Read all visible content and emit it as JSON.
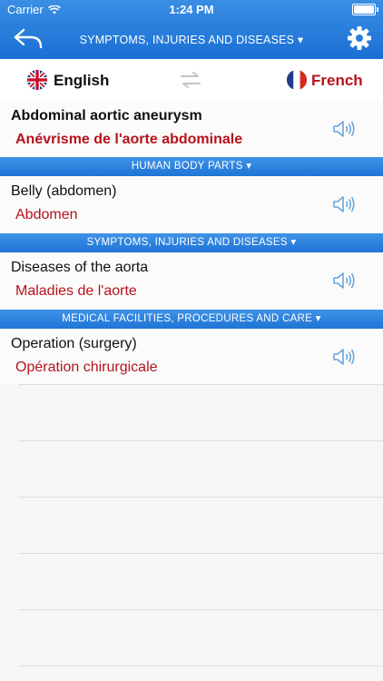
{
  "status": {
    "carrier": "Carrier",
    "time": "1:24 PM"
  },
  "nav": {
    "title": "SYMPTOMS, INJURIES AND DISEASES ▾",
    "back_icon": "back-arrow-icon",
    "settings_icon": "gear-icon"
  },
  "languages": {
    "source": "English",
    "target": "French"
  },
  "entries": [
    {
      "source": "Abdominal aortic aneurysm",
      "target": "Anévrisme de l'aorte abdominale"
    },
    {
      "source": "Belly (abdomen)",
      "target": "Abdomen"
    },
    {
      "source": "Diseases of the aorta",
      "target": "Maladies de l'aorte"
    },
    {
      "source": "Operation (surgery)",
      "target": "Opération chirurgicale"
    }
  ],
  "sections": [
    "HUMAN BODY PARTS ▾",
    "SYMPTOMS, INJURIES AND DISEASES ▾",
    "MEDICAL FACILITIES, PROCEDURES AND CARE ▾"
  ],
  "colors": {
    "accent": "#1a6fd4",
    "target_text": "#b5121b"
  }
}
